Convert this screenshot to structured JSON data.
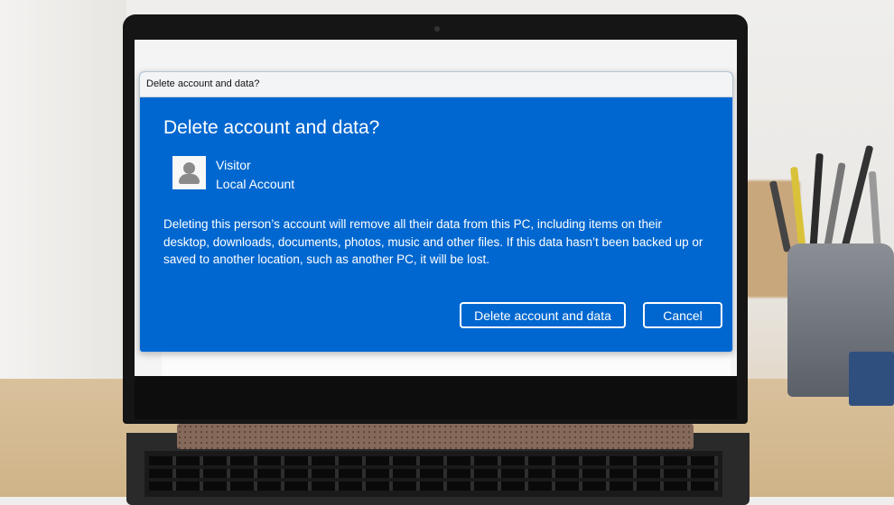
{
  "dialog": {
    "title_bar": "Delete account and data?",
    "heading": "Delete account and data?",
    "account": {
      "name": "Visitor",
      "type": "Local Account",
      "avatar_icon": "user-silhouette-icon"
    },
    "message": "Deleting this person’s account will remove all their data from this PC, including items on their desktop, downloads, documents, photos, music and other files. If this data hasn’t been backed up or saved to another location, such as another PC, it will be lost.",
    "buttons": {
      "delete_label": "Delete account and data",
      "cancel_label": "Cancel"
    },
    "colors": {
      "background": "#0067d0",
      "text": "#ffffff"
    }
  }
}
